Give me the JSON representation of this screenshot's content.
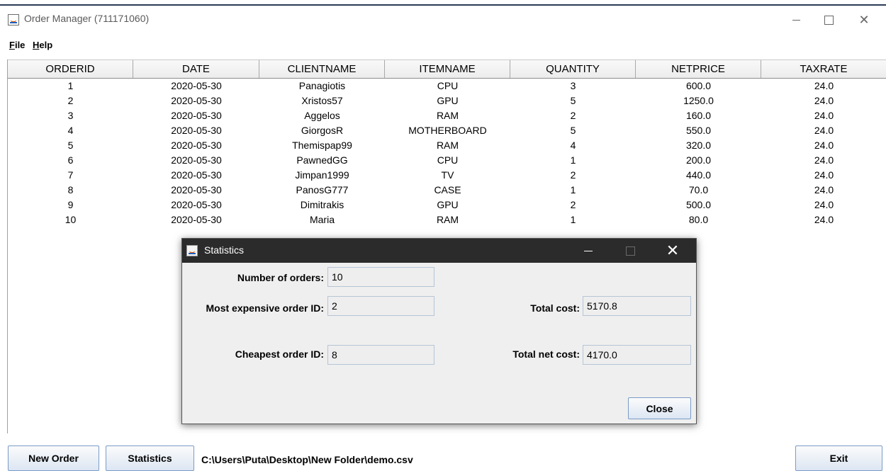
{
  "window": {
    "title": "Order Manager (711171060)"
  },
  "menu": {
    "file_accel": "F",
    "file_rest": "ile",
    "help_accel": "H",
    "help_rest": "elp"
  },
  "table": {
    "columns": [
      "ORDERID",
      "DATE",
      "CLIENTNAME",
      "ITEMNAME",
      "QUANTITY",
      "NETPRICE",
      "TAXRATE"
    ],
    "rows": [
      [
        "1",
        "2020-05-30",
        "Panagiotis",
        "CPU",
        "3",
        "600.0",
        "24.0"
      ],
      [
        "2",
        "2020-05-30",
        "Xristos57",
        "GPU",
        "5",
        "1250.0",
        "24.0"
      ],
      [
        "3",
        "2020-05-30",
        "Aggelos",
        "RAM",
        "2",
        "160.0",
        "24.0"
      ],
      [
        "4",
        "2020-05-30",
        "GiorgosR",
        "MOTHERBOARD",
        "5",
        "550.0",
        "24.0"
      ],
      [
        "5",
        "2020-05-30",
        "Themispap99",
        "RAM",
        "4",
        "320.0",
        "24.0"
      ],
      [
        "6",
        "2020-05-30",
        "PawnedGG",
        "CPU",
        "1",
        "200.0",
        "24.0"
      ],
      [
        "7",
        "2020-05-30",
        "Jimpan1999",
        "TV",
        "2",
        "440.0",
        "24.0"
      ],
      [
        "8",
        "2020-05-30",
        "PanosG777",
        "CASE",
        "1",
        "70.0",
        "24.0"
      ],
      [
        "9",
        "2020-05-30",
        "Dimitrakis",
        "GPU",
        "2",
        "500.0",
        "24.0"
      ],
      [
        "10",
        "2020-05-30",
        "Maria",
        "RAM",
        "1",
        "80.0",
        "24.0"
      ]
    ]
  },
  "bottom": {
    "new_order_label": "New Order",
    "statistics_label": "Statistics",
    "file_path": "C:\\Users\\Puta\\Desktop\\New Folder\\demo.csv",
    "exit_label": "Exit"
  },
  "dialog": {
    "title": "Statistics",
    "orders_label": "Number of orders:",
    "orders_value": "10",
    "expensive_label": "Most expensive order ID:",
    "expensive_value": "2",
    "total_label": "Total cost:",
    "total_value": "5170.8",
    "cheapest_label": "Cheapest order ID:",
    "cheapest_value": "8",
    "total_net_label": "Total net cost:",
    "total_net_value": "4170.0",
    "close_label": "Close"
  },
  "icons": {
    "app": "java-app-icon",
    "minimize": "minimize-icon",
    "maximize": "maximize-icon",
    "close": "close-icon"
  }
}
